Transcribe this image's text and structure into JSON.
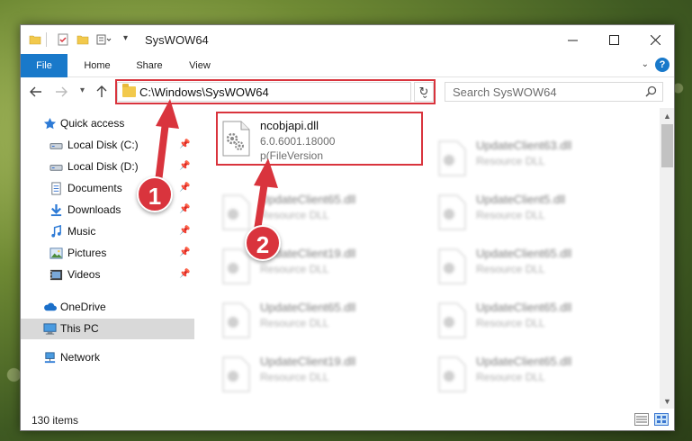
{
  "window": {
    "title": "SysWOW64"
  },
  "ribbon": {
    "tabs": [
      {
        "label": "File"
      },
      {
        "label": "Home"
      },
      {
        "label": "Share"
      },
      {
        "label": "View"
      }
    ],
    "help": "?"
  },
  "navigation": {
    "address": "C:\\Windows\\SysWOW64",
    "search_placeholder": "Search SysWOW64"
  },
  "sidebar": {
    "items": [
      {
        "label": "Quick access",
        "icon": "star-icon",
        "pinned": false
      },
      {
        "label": "Local Disk (C:)",
        "icon": "drive-icon",
        "pinned": true
      },
      {
        "label": "Local Disk (D:)",
        "icon": "drive-icon",
        "pinned": true
      },
      {
        "label": "Documents",
        "icon": "documents-icon",
        "pinned": true
      },
      {
        "label": "Downloads",
        "icon": "download-icon",
        "pinned": true
      },
      {
        "label": "Music",
        "icon": "music-icon",
        "pinned": true
      },
      {
        "label": "Pictures",
        "icon": "pictures-icon",
        "pinned": true
      },
      {
        "label": "Videos",
        "icon": "videos-icon",
        "pinned": true
      },
      {
        "label": "OneDrive",
        "icon": "cloud-icon",
        "pinned": false
      },
      {
        "label": "This PC",
        "icon": "computer-icon",
        "pinned": false,
        "selected": true
      },
      {
        "label": "Network",
        "icon": "network-icon",
        "pinned": false
      }
    ]
  },
  "files": {
    "focused": {
      "name": "ncobjapi.dll",
      "version": "6.0.6001.18000",
      "description": "p(FileVersion"
    },
    "left_column": [
      {
        "name": "UpdateClient65.dll",
        "description": "Resource DLL"
      },
      {
        "name": "UpdateClient19.dll",
        "description": "Resource DLL"
      },
      {
        "name": "UpdateClient65.dll",
        "description": "Resource DLL"
      },
      {
        "name": "UpdateClient19.dll",
        "description": "Resource DLL"
      }
    ],
    "right_column": [
      {
        "name": "UpdateClient63.dll",
        "description": "Resource DLL"
      },
      {
        "name": "UpdateClient5.dll",
        "description": "Resource DLL"
      },
      {
        "name": "UpdateClient65.dll",
        "description": "Resource DLL"
      },
      {
        "name": "UpdateClient65.dll",
        "description": "Resource DLL"
      },
      {
        "name": "UpdateClient65.dll",
        "description": "Resource DLL"
      }
    ]
  },
  "status": {
    "item_count": "130 items"
  },
  "callouts": {
    "one": "1",
    "two": "2"
  },
  "colors": {
    "accent": "#1979ca",
    "highlight": "#d9343d",
    "selected": "#d9d9d9"
  }
}
